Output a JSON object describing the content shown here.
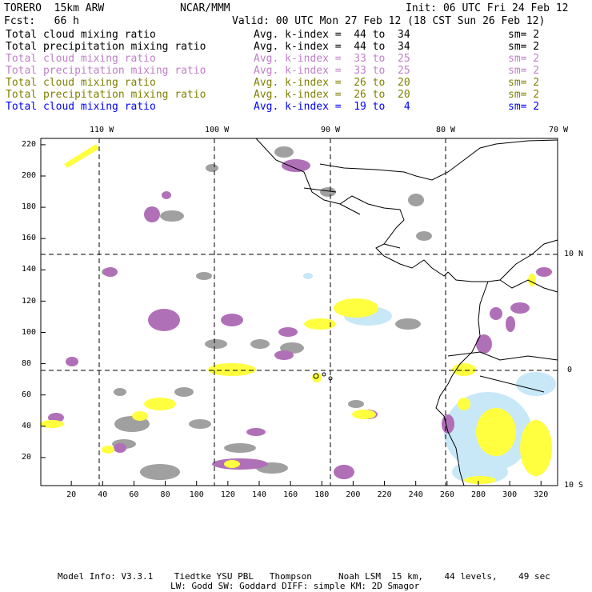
{
  "header": {
    "model": "TORERO  15km ARW",
    "org": "NCAR/MMM",
    "init": "Init: 06 UTC Fri 24 Feb 12",
    "fcst": "Fcst:   66 h",
    "valid": "Valid: 00 UTC Mon 27 Feb 12 (18 CST Sun 26 Feb 12)"
  },
  "legend": [
    {
      "field": "Total cloud mixing ratio",
      "range": "Avg. k-index =  44 to  34",
      "sm": "sm= 2",
      "color": "#000000"
    },
    {
      "field": "Total precipitation mixing ratio",
      "range": "Avg. k-index =  44 to  34",
      "sm": "sm= 2",
      "color": "#000000"
    },
    {
      "field": "Total cloud mixing ratio",
      "range": "Avg. k-index =  33 to  25",
      "sm": "sm= 2",
      "color": "#c080c8"
    },
    {
      "field": "Total precipitation mixing ratio",
      "range": "Avg. k-index =  33 to  25",
      "sm": "sm= 2",
      "color": "#c080c8"
    },
    {
      "field": "Total cloud mixing ratio",
      "range": "Avg. k-index =  26 to  20",
      "sm": "sm= 2",
      "color": "#808000"
    },
    {
      "field": "Total precipitation mixing ratio",
      "range": "Avg. k-index =  26 to  20",
      "sm": "sm= 2",
      "color": "#808000"
    },
    {
      "field": "Total cloud mixing ratio",
      "range": "Avg. k-index =  19 to   4",
      "sm": "sm= 2",
      "color": "#0000ff"
    }
  ],
  "axes": {
    "top": [
      "110 W",
      "100 W",
      "90 W",
      "80 W",
      "70 W"
    ],
    "right": [
      "10 N",
      "0",
      "10 S"
    ],
    "left": [
      "220",
      "200",
      "180",
      "160",
      "140",
      "120",
      "100",
      "80",
      "60",
      "40",
      "20"
    ],
    "bottom": [
      "20",
      "40",
      "60",
      "80",
      "100",
      "120",
      "140",
      "160",
      "180",
      "200",
      "220",
      "240",
      "260",
      "280",
      "300",
      "320"
    ]
  },
  "footer": {
    "line1": "Model Info: V3.3.1    Tiedtke YSU PBL   Thompson     Noah LSM  15 km,    44 levels,    49 sec",
    "line2": "LW: Godd SW: Goddard DIFF: simple KM: 2D Smagor"
  },
  "colors": {
    "gray": "#a0a0a0",
    "purple": "#b070b8",
    "yellow": "#ffff40",
    "lightblue": "#c8e8f8"
  }
}
